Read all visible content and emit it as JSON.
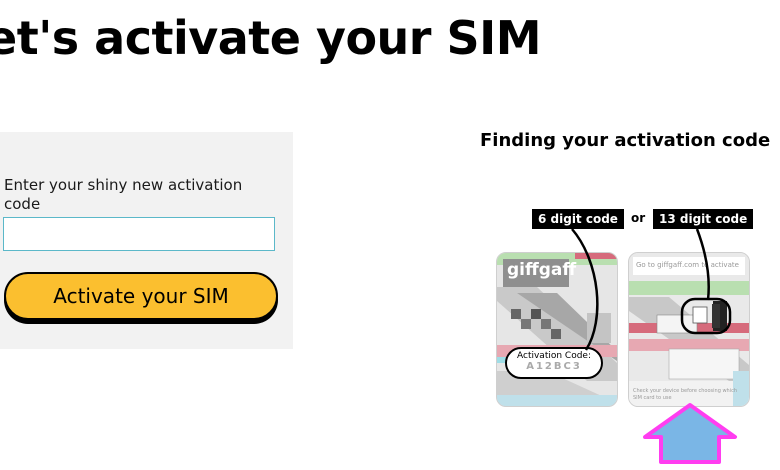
{
  "header": {
    "title": "et's activate your SIM"
  },
  "form": {
    "label": "Enter your shiny new activation code",
    "input_value": "",
    "input_placeholder": "",
    "button_label": "Activate your SIM"
  },
  "help": {
    "title": "Finding your activation code",
    "left_tag": "6 digit code",
    "or_text": "or",
    "right_tag": "13  digit code",
    "left_card": {
      "brand": "giffgaff",
      "code_label": "Activation Code:",
      "code_value": "A12BC3"
    },
    "right_card": {
      "top_hint": "Go to giffgaff.com to activate",
      "bottom_hint": "Check your device before choosing which SIM card to use"
    }
  },
  "colors": {
    "button": "#fbbf2f",
    "panel": "#f2f2f2",
    "input_border": "#5bb8c9",
    "arrow_fill": "#7ab6e6",
    "arrow_outline": "#ff3df0"
  },
  "icons": {
    "pointer": "up-arrow-icon"
  }
}
